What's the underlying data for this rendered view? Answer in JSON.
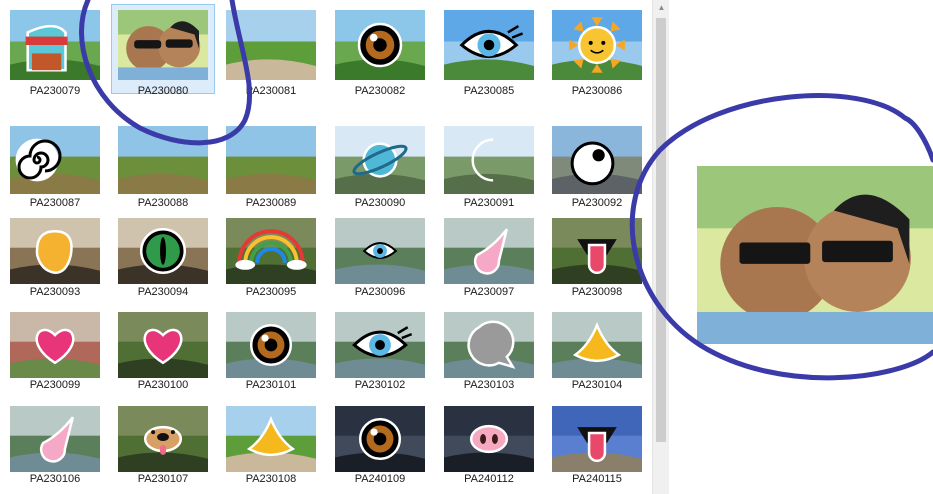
{
  "files": [
    {
      "name": "PA230079",
      "scene": "garden",
      "sticker": "cat-sticker",
      "selected": false
    },
    {
      "name": "PA230080",
      "scene": "selfie",
      "sticker": "none",
      "selected": true
    },
    {
      "name": "PA230081",
      "scene": "path",
      "sticker": "none",
      "selected": false
    },
    {
      "name": "PA230082",
      "scene": "garden",
      "sticker": "eye-sticker",
      "selected": false
    },
    {
      "name": "PA230085",
      "scene": "sky",
      "sticker": "eye-lashes-sticker",
      "selected": false
    },
    {
      "name": "PA230086",
      "scene": "sky",
      "sticker": "sun-sticker",
      "selected": false
    },
    {
      "name": "PA230087",
      "scene": "field",
      "sticker": "spiral-sticker",
      "selected": false
    },
    {
      "name": "PA230088",
      "scene": "field",
      "sticker": "none",
      "selected": false
    },
    {
      "name": "PA230089",
      "scene": "field",
      "sticker": "none",
      "selected": false
    },
    {
      "name": "PA230090",
      "scene": "tree",
      "sticker": "planet-sticker",
      "selected": false
    },
    {
      "name": "PA230091",
      "scene": "tree",
      "sticker": "moon-sticker",
      "selected": false
    },
    {
      "name": "PA230092",
      "scene": "street",
      "sticker": "eyeball-sticker",
      "selected": false
    },
    {
      "name": "PA230093",
      "scene": "room",
      "sticker": "blob-sticker",
      "selected": false
    },
    {
      "name": "PA230094",
      "scene": "room",
      "sticker": "green-eye-sticker",
      "selected": false
    },
    {
      "name": "PA230095",
      "scene": "park",
      "sticker": "rainbow-sticker",
      "selected": false
    },
    {
      "name": "PA230096",
      "scene": "lake",
      "sticker": "small-eye-sticker",
      "selected": false
    },
    {
      "name": "PA230097",
      "scene": "lake",
      "sticker": "pink-drop-sticker",
      "selected": false
    },
    {
      "name": "PA230098",
      "scene": "park",
      "sticker": "tongue-sticker",
      "selected": false
    },
    {
      "name": "PA230099",
      "scene": "arch",
      "sticker": "heart-sticker",
      "selected": false
    },
    {
      "name": "PA230100",
      "scene": "park",
      "sticker": "heart-sticker",
      "selected": false
    },
    {
      "name": "PA230101",
      "scene": "lake",
      "sticker": "eye-sticker",
      "selected": false
    },
    {
      "name": "PA230102",
      "scene": "lake",
      "sticker": "eye-lashes-sticker",
      "selected": false
    },
    {
      "name": "PA230103",
      "scene": "lake",
      "sticker": "grey-drop-sticker",
      "selected": false
    },
    {
      "name": "PA230104",
      "scene": "lake",
      "sticker": "nose-sticker",
      "selected": false
    },
    {
      "name": "PA230106",
      "scene": "lake",
      "sticker": "pink-drop-sticker",
      "selected": false
    },
    {
      "name": "PA230107",
      "scene": "park",
      "sticker": "dog-sticker",
      "selected": false
    },
    {
      "name": "PA230108",
      "scene": "path",
      "sticker": "nose-sticker",
      "selected": false
    },
    {
      "name": "PA240109",
      "scene": "night",
      "sticker": "eye-sticker",
      "selected": false
    },
    {
      "name": "PA240112",
      "scene": "night",
      "sticker": "pig-nose-sticker",
      "selected": false
    },
    {
      "name": "PA240115",
      "scene": "wall",
      "sticker": "tongue-sticker",
      "selected": false
    }
  ],
  "preview": {
    "file": "PA230080",
    "scene": "selfie"
  },
  "colors": {
    "selection_fill": "#dcecfb",
    "selection_border": "#99c9f0",
    "annotation_ink": "#3a3aa8"
  }
}
